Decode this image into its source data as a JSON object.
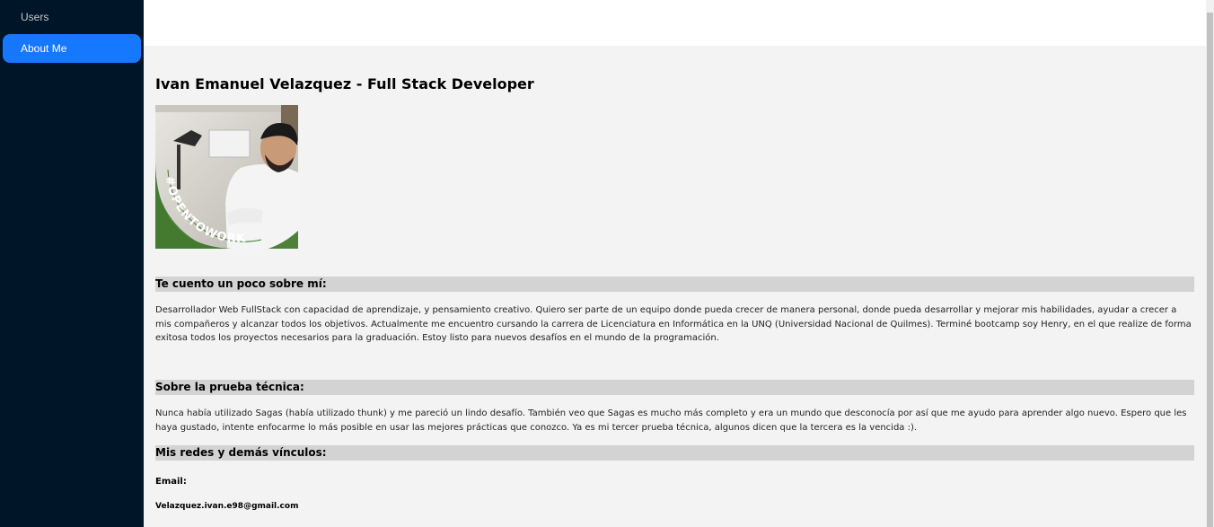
{
  "sidebar": {
    "items": [
      {
        "label": "Users",
        "active": false
      },
      {
        "label": "About Me",
        "active": true
      }
    ]
  },
  "colors": {
    "sidebar_bg": "#011529",
    "active_item": "#1677ff",
    "section_bg": "#d3d3d3",
    "content_bg": "#f3f3f3"
  },
  "main": {
    "title": "Ivan Emanuel Velazquez - Full Stack Developer",
    "photo": {
      "icon": "profile-photo",
      "banner_text": "#OPENTOWORK"
    },
    "sections": [
      {
        "heading": "Te cuento un poco sobre mí:",
        "text": "Desarrollador Web FullStack con capacidad de aprendizaje, y pensamiento creativo. Quiero ser parte de un equipo donde pueda crecer de manera personal, donde pueda desarrollar y mejorar mis habilidades, ayudar a crecer a mis compañeros y alcanzar todos los objetivos. Actualmente me encuentro cursando la carrera de Licenciatura en Informática en la UNQ (Universidad Nacional de Quilmes). Terminé bootcamp soy Henry, en el que realize de forma exitosa todos los proyectos necesarios para la graduación. Estoy listo para nuevos desafíos en el mundo de la programación."
      },
      {
        "heading": "Sobre la prueba técnica:",
        "text": "Nunca había utilizado Sagas (había utilizado thunk) y me pareció un lindo desafío. También veo que Sagas es mucho más completo y era un mundo que desconocía por así que me ayudo para aprender algo nuevo. Espero que les haya gustado, intente enfocarme lo más posible en usar las mejores prácticas que conozco. Ya es mi tercer prueba técnica, algunos dicen que la tercera es la vencida :)."
      },
      {
        "heading": "Mis redes y demás vínculos:"
      }
    ],
    "email_label": "Email:",
    "email_value": "Velazquez.ivan.e98@gmail.com"
  }
}
